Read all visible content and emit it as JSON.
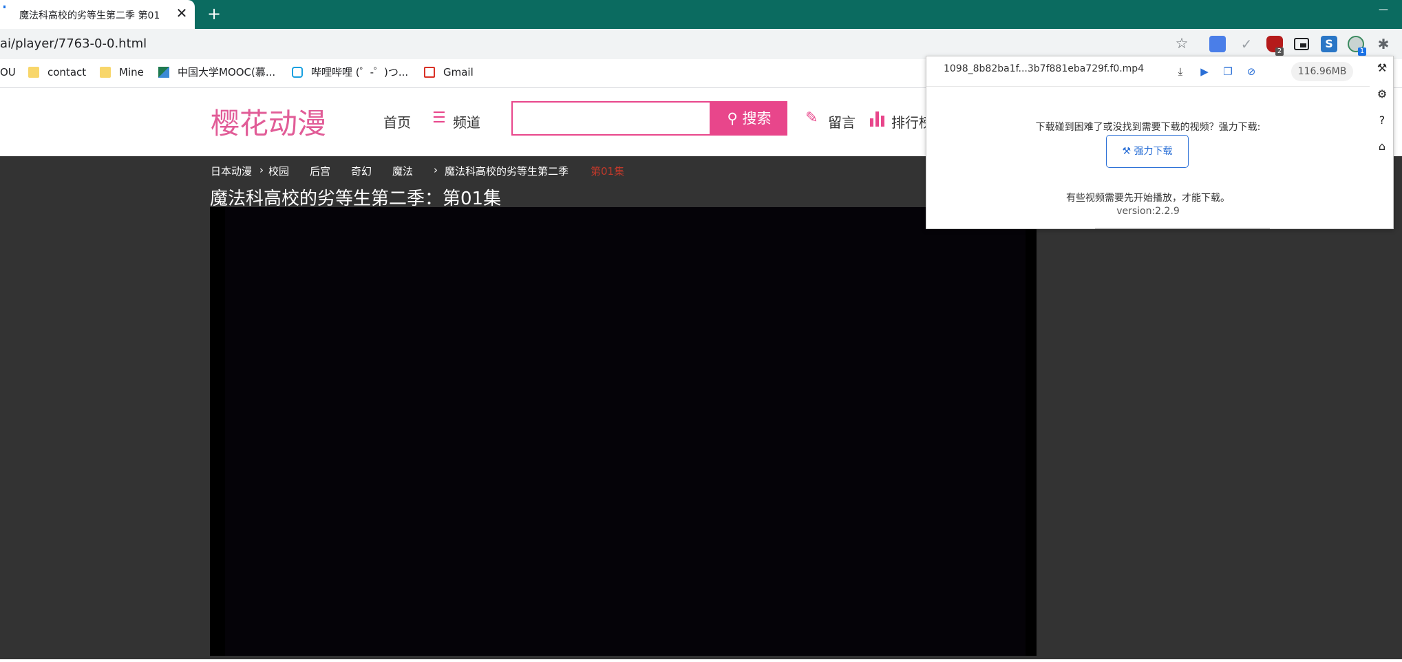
{
  "browser": {
    "tab_title": "魔法科高校的劣等生第二季 第01",
    "tab_close": "✕",
    "new_tab": "+",
    "minimize": "—",
    "url_visible": "ai/player/7763-0-0.html",
    "ublock_badge": "2",
    "downloader_badge": "1"
  },
  "bookmarks": [
    {
      "label": "OU"
    },
    {
      "label": "contact",
      "icon": "folder-icon"
    },
    {
      "label": "Mine",
      "icon": "folder-icon"
    },
    {
      "label": "中国大学MOOC(慕...",
      "icon": "mooc-icon"
    },
    {
      "label": "哔哩哔哩 (゜-゜)つ...",
      "icon": "bilibili-icon"
    },
    {
      "label": "Gmail",
      "icon": "gmail-icon"
    }
  ],
  "site": {
    "logo": "樱花动漫",
    "nav_home": "首页",
    "nav_channel": "频道",
    "search_button": "搜索",
    "nav_message": "留言",
    "nav_ranking": "排行榜"
  },
  "breadcrumbs": [
    "日本动漫",
    "校园",
    "后宫",
    "奇幻",
    "魔法",
    "魔法科高校的劣等生第二季",
    "第01集"
  ],
  "episode_title": "魔法科高校的劣等生第二季：第01集",
  "downloader": {
    "filename": "1098_8b82ba1f...3b7f881eba729f.f0.mp4",
    "size": "116.96MB",
    "help_text": "下载碰到困难了或没找到需要下载的视频？强力下载:",
    "force_button": "强力下载",
    "note": "有些视频需要先开始播放，才能下载。",
    "version": "version:2.2.9"
  },
  "colors": {
    "tabbar": "#0b6b60",
    "brand_pink": "#e8468b",
    "logo_pink": "#e15c97",
    "popup_blue": "#2a6fd6",
    "page_dark": "#333333",
    "crumb_current": "#c0392b"
  }
}
